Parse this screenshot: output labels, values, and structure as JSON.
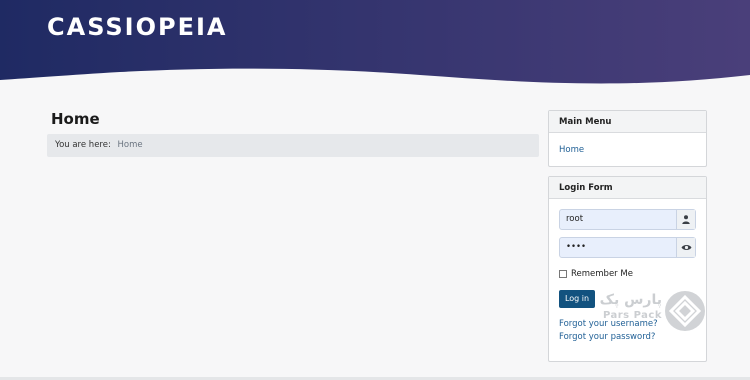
{
  "header": {
    "brand": "CASSIOPEIA",
    "gradient_start": "#1f2a63",
    "gradient_end": "#4a3f7a"
  },
  "main": {
    "title": "Home",
    "breadcrumb": {
      "prefix": "You are here:",
      "current": "Home"
    }
  },
  "main_menu": {
    "title": "Main Menu",
    "items": [
      {
        "label": "Home"
      }
    ]
  },
  "login_form": {
    "title": "Login Form",
    "username_value": "root",
    "password_value": "••••",
    "username_icon": "user-icon",
    "password_icon": "eye-icon",
    "remember_label": "Remember Me",
    "login_button": "Log in",
    "forgot_username": "Forgot your username?",
    "forgot_password": "Forgot your password?"
  },
  "watermark": {
    "arabic": "پارس پک",
    "latin": "Pars Pack"
  },
  "colors": {
    "accent": "#12527f",
    "link": "#1f5f95",
    "background": "#f7f7f8"
  }
}
